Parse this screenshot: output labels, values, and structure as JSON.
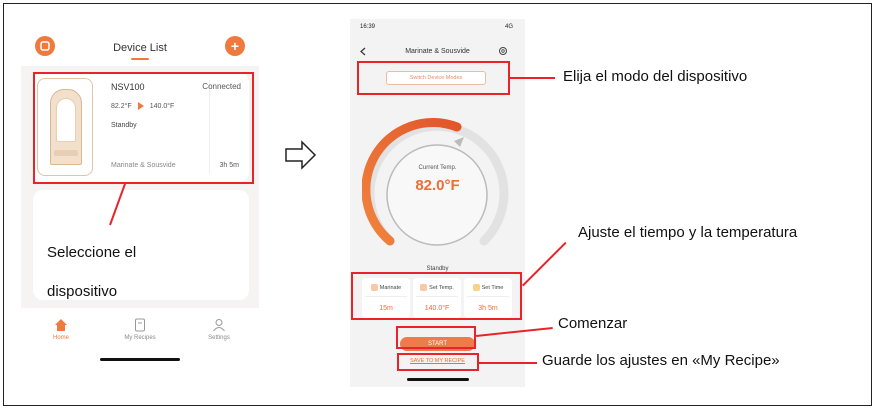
{
  "left_screen": {
    "header_title": "Device List",
    "device": {
      "name": "NSV100",
      "status": "Connected",
      "current_temp": "82.2°F",
      "target_temp": "140.0°F",
      "state": "Standby",
      "mode": "Marinate & Sousvide",
      "time": "3h 5m"
    },
    "tabs": [
      {
        "label": "Home",
        "icon": "home-icon",
        "active": true
      },
      {
        "label": "My Recipes",
        "icon": "recipe-book-icon",
        "active": false
      },
      {
        "label": "Settings",
        "icon": "user-settings-icon",
        "active": false
      }
    ]
  },
  "right_screen": {
    "status_time": "16:39",
    "status_right": "4G",
    "title": "Marinate & Sousvide",
    "switch_modes": "Switch Device Modes",
    "current_temp_label": "Current Temp.",
    "current_temp": "82.0°F",
    "state": "Standby",
    "settings": [
      {
        "label": "Marinate",
        "value": "15m"
      },
      {
        "label": "Set Temp.",
        "value": "140.0°F"
      },
      {
        "label": "Set Time",
        "value": "3h 5m"
      }
    ],
    "start": "START",
    "save": "SAVE TO MY RECIPE"
  },
  "captions": {
    "select_device_1": "Seleccione el",
    "select_device_2": "dispositivo",
    "choose_mode": "Elija el modo del dispositivo",
    "set_time_temp": "Ajuste el tiempo y la temperatura",
    "start": "Comenzar",
    "save_recipe": "Guarde los ajustes en «My Recipe»"
  },
  "colors": {
    "accent": "#ef7a3e",
    "highlight": "#e8232a"
  }
}
